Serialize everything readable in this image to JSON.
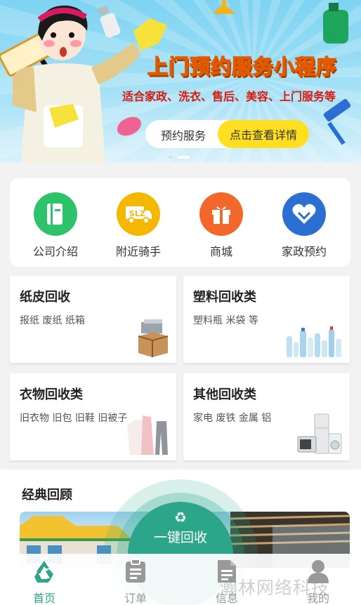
{
  "banner": {
    "title": "上门预约服务小程序",
    "subtitle": "适合家政、洗衣、售后、美容、上门服务等",
    "pill_left": "预约服务",
    "pill_right": "点击查看详情",
    "active_dot": 2
  },
  "categories": [
    {
      "label": "公司介绍",
      "icon": "book-icon",
      "color": "#2ec36a"
    },
    {
      "label": "附近骑手",
      "icon": "delivery-truck-icon",
      "color": "#f5b800"
    },
    {
      "label": "商城",
      "icon": "gift-box-icon",
      "color": "#f4672b"
    },
    {
      "label": "家政预约",
      "icon": "heart-icon",
      "color": "#2a6fd1"
    }
  ],
  "tiles": [
    {
      "title": "纸皮回收",
      "desc": "报纸 废纸 纸箱",
      "image": "cardboard-boxes-image"
    },
    {
      "title": "塑料回收类",
      "desc": "塑料瓶 米袋 等",
      "image": "plastic-bottles-image"
    },
    {
      "title": "衣物回收类",
      "desc": "旧衣物 旧包 旧鞋 旧被子",
      "image": "clothes-image"
    },
    {
      "title": "其他回收类",
      "desc": "家电 废铁 金属 铝",
      "image": "appliances-image"
    }
  ],
  "review": {
    "title": "经典回顾"
  },
  "one_key": {
    "icon": "recycle-icon",
    "label": "一键回收"
  },
  "tabs": [
    {
      "label": "首页",
      "icon": "recycle-icon",
      "active": true
    },
    {
      "label": "订单",
      "icon": "clipboard-icon",
      "active": false
    },
    {
      "label": "信息",
      "icon": "document-icon",
      "active": false
    },
    {
      "label": "我的",
      "icon": "user-icon",
      "active": false
    }
  ],
  "watermark": "瀚林网络科技",
  "colors": {
    "accent": "#2ca68a",
    "banner_sky": "#7dd3f2",
    "pill_yellow": "#ffdf1f"
  }
}
